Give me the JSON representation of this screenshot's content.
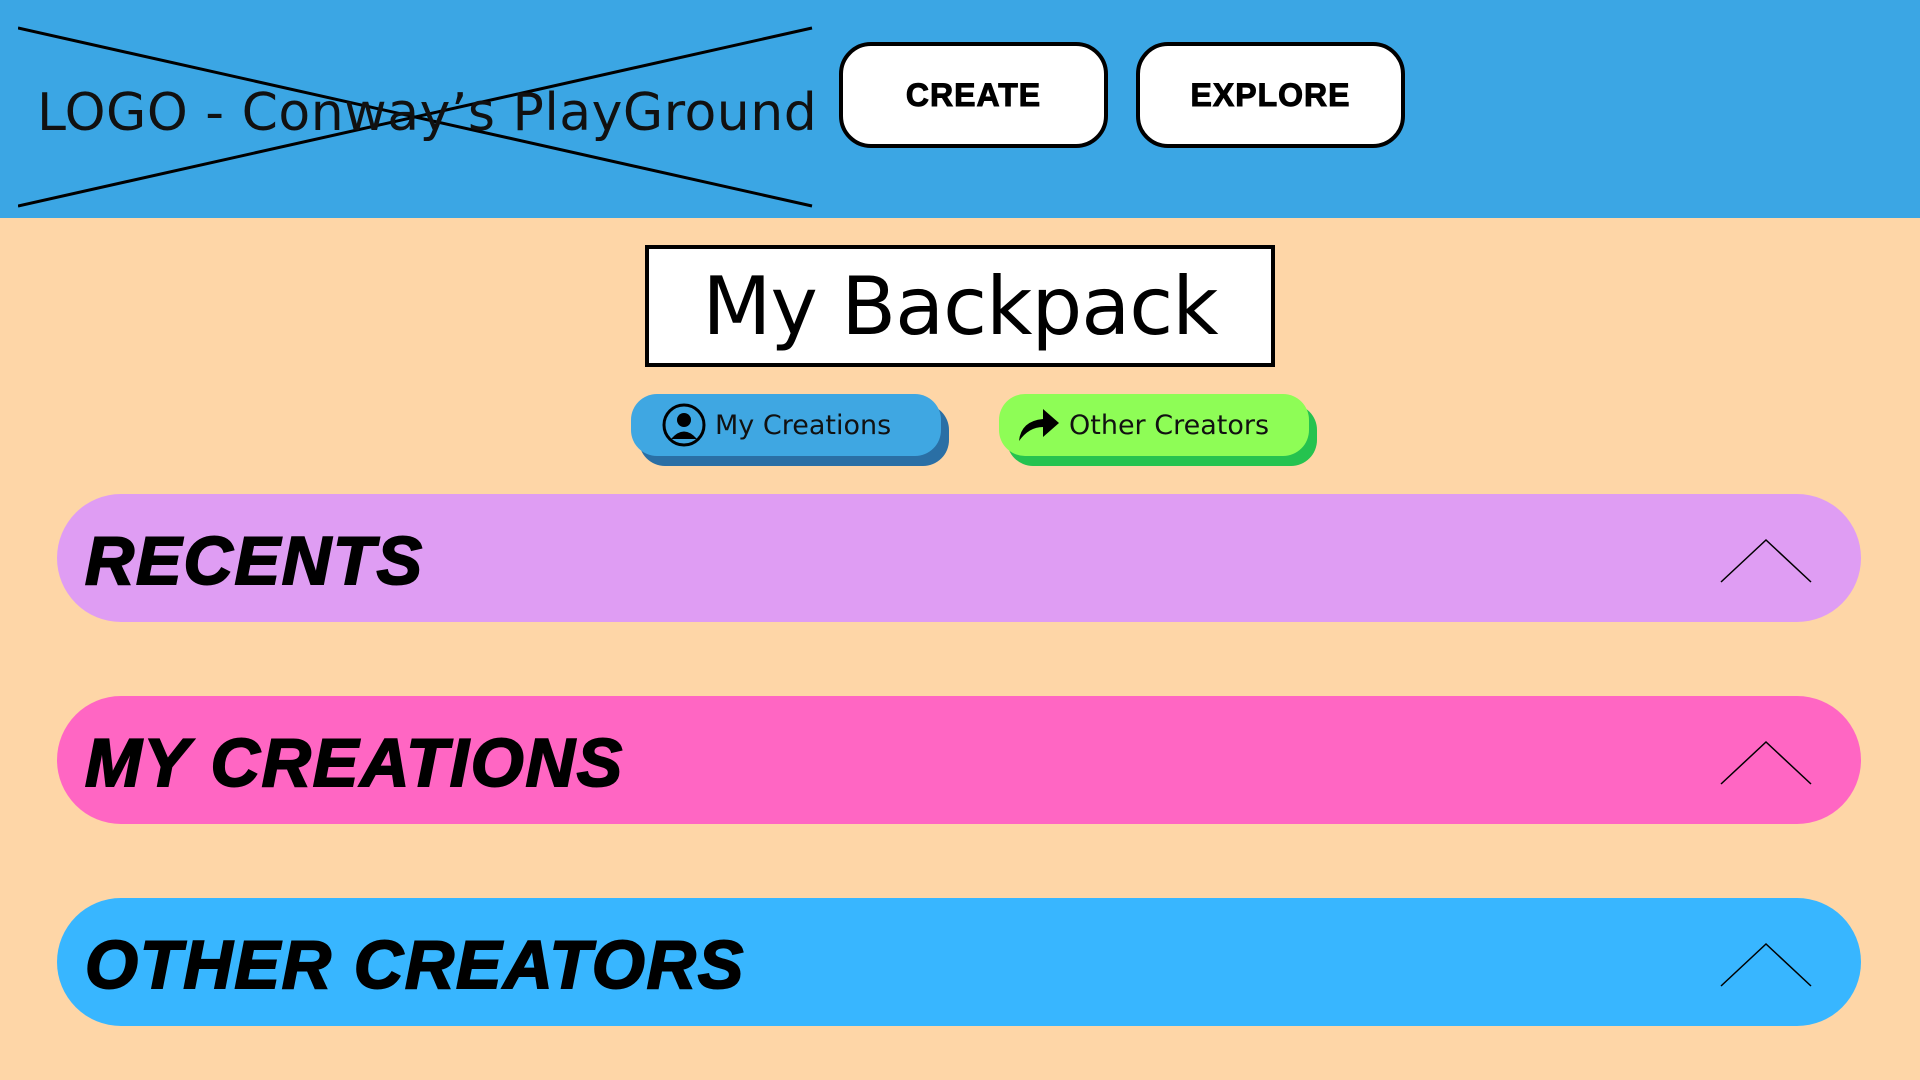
{
  "header": {
    "logo_text": "LOGO - Conway’s PlayGround",
    "nav": {
      "create_label": "CREATE",
      "explore_label": "EXPLORE"
    }
  },
  "page": {
    "title": "My Backpack"
  },
  "filters": {
    "my_creations": {
      "label": "My Creations",
      "icon": "user-circle-icon",
      "color": "#3FA7E2"
    },
    "other_creators": {
      "label": "Other Creators",
      "icon": "share-arrow-icon",
      "color": "#8EFD56"
    }
  },
  "sections": [
    {
      "label": "RECENTS",
      "color": "#DF9DF3",
      "icon": "chevron-up-icon"
    },
    {
      "label": "MY CREATIONS",
      "color": "#FF66C3",
      "icon": "chevron-up-icon"
    },
    {
      "label": "OTHER CREATORS",
      "color": "#38B6FF",
      "icon": "chevron-up-icon"
    }
  ],
  "colors": {
    "header_bg": "#3BA6E4",
    "page_bg": "#FED6A7"
  }
}
